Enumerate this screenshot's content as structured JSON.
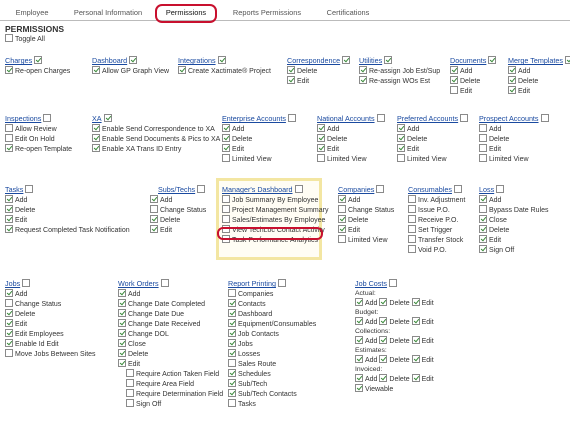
{
  "tabs": [
    {
      "label": "Employee",
      "active": false
    },
    {
      "label": "Personal Information",
      "active": false
    },
    {
      "label": "Permissions",
      "active": true
    },
    {
      "label": "Reports Permissions",
      "active": false
    },
    {
      "label": "Certifications",
      "active": false
    }
  ],
  "title": "PERMISSIONS",
  "toggle_all": "Toggle All",
  "row1": {
    "charges": {
      "header": "Charges",
      "items": [
        "Re-open Charges"
      ]
    },
    "dashboard": {
      "header": "Dashboard",
      "items": [
        "Allow GP Graph View"
      ]
    },
    "integrations": {
      "header": "Integrations",
      "items": [
        "Create Xactimate® Project"
      ]
    },
    "correspondence": {
      "header": "Correspondence",
      "items": [
        "Delete",
        "Edit"
      ]
    },
    "utilities": {
      "header": "Utilities",
      "items": [
        "Re-assign Job Est/Sup",
        "Re-assign WOs Est"
      ]
    },
    "documents": {
      "header": "Documents",
      "items": [
        "Add",
        "Delete",
        "Edit"
      ]
    },
    "merge_templates": {
      "header": "Merge Templates",
      "items": [
        "Add",
        "Delete",
        "Edit"
      ]
    }
  },
  "row2": {
    "inspections": {
      "header": "Inspections",
      "items": [
        "Allow Review",
        "Edit On Hold",
        "Re-open Template"
      ]
    },
    "xa": {
      "header": "XA",
      "items": [
        "Enable Send Correspondence to XA",
        "Enable Send Documents & Pics to XA",
        "Enable XA Trans ID Entry"
      ]
    },
    "enterprise_accounts": {
      "header": "Enterprise Accounts",
      "items": [
        "Add",
        "Delete",
        "Edit",
        "Limited View"
      ]
    },
    "national_accounts": {
      "header": "National Accounts",
      "items": [
        "Add",
        "Delete",
        "Edit",
        "Limited View"
      ]
    },
    "preferred_accounts": {
      "header": "Preferred Accounts",
      "items": [
        "Add",
        "Delete",
        "Edit",
        "Limited View"
      ]
    },
    "prospect_accounts": {
      "header": "Prospect Accounts",
      "items": [
        "Add",
        "Delete",
        "Edit",
        "Limited View"
      ]
    }
  },
  "row3": {
    "tasks": {
      "header": "Tasks",
      "items": [
        "Add",
        "Delete",
        "Edit",
        "Request Completed Task Notification"
      ]
    },
    "subs_techs": {
      "header": "Subs/Techs",
      "items": [
        "Add",
        "Change Status",
        "Delete",
        "Edit"
      ]
    },
    "managers_dashboard": {
      "header": "Manager's Dashboard",
      "items": [
        "Job Summary By Employee",
        "Project Management Summary",
        "Sales/Estimates By Employee",
        "View TechLoc Contact Activity",
        "Task Performance Analytics"
      ]
    },
    "companies": {
      "header": "Companies",
      "items": [
        "Add",
        "Change Status",
        "Delete",
        "Edit",
        "Limited View"
      ]
    },
    "consumables": {
      "header": "Consumables",
      "items": [
        "Inv. Adjustment",
        "Issue P.O.",
        "Receive P.O.",
        "Set Trigger",
        "Transfer Stock",
        "Void P.O."
      ]
    },
    "loss": {
      "header": "Loss",
      "items": [
        "Add",
        "Bypass Date Rules",
        "Close",
        "Delete",
        "Edit",
        "Sign Off"
      ]
    }
  },
  "row4": {
    "jobs": {
      "header": "Jobs",
      "items": [
        "Add",
        "Change Status",
        "Delete",
        "Edit",
        "Edit Employees",
        "Enable Id Edit",
        "Move Jobs Between Sites"
      ]
    },
    "work_orders": {
      "header": "Work Orders",
      "items": [
        "Add",
        "Change Date Completed",
        "Change Date Due",
        "Change Date Received",
        "Change DOL",
        "Close",
        "Delete",
        "Edit",
        "Require Action Taken Field",
        "Require Area Field",
        "Require Determination Field",
        "Sign Off"
      ]
    },
    "report_printing": {
      "header": "Report Printing",
      "items": [
        "Companies",
        "Contacts",
        "Dashboard",
        "Equipment/Consumables",
        "Job Contacts",
        "Jobs",
        "Losses",
        "Sales Route",
        "Schedules",
        "Sub/Tech",
        "Sub/Tech Contacts",
        "Tasks"
      ]
    },
    "job_costs": {
      "header": "Job Costs",
      "groups": [
        {
          "label": "Actual:",
          "items": [
            "Add",
            "Delete",
            "Edit"
          ]
        },
        {
          "label": "Budget:",
          "items": [
            "Add",
            "Delete",
            "Edit"
          ]
        },
        {
          "label": "Collections:",
          "items": [
            "Add",
            "Delete",
            "Edit"
          ]
        },
        {
          "label": "Estimates:",
          "items": [
            "Add",
            "Delete",
            "Edit"
          ]
        },
        {
          "label": "Invoiced:",
          "items": [
            "Add",
            "Delete",
            "Edit"
          ]
        }
      ],
      "viewable": "Viewable"
    }
  },
  "colors": {
    "link": "#1a4aa0",
    "highlight_red": "#c8102e",
    "highlight_yellow": "#f3e6a2",
    "check": "#3a8a3a"
  }
}
